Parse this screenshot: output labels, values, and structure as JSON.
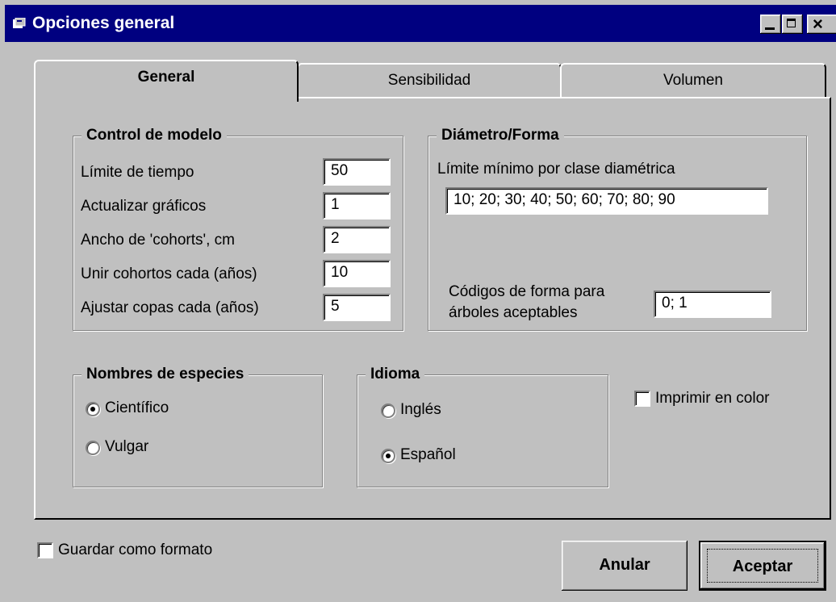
{
  "window": {
    "title": "Opciones general"
  },
  "tabs": [
    "General",
    "Sensibilidad",
    "Volumen"
  ],
  "control_modelo": {
    "legend": "Control de modelo",
    "rows": [
      {
        "label": "Límite de tiempo",
        "value": "50"
      },
      {
        "label": "Actualizar gráficos",
        "value": "1"
      },
      {
        "label": "Ancho de 'cohorts', cm",
        "value": "2"
      },
      {
        "label": "Unir cohortos cada (años)",
        "value": "10"
      },
      {
        "label": "Ajustar copas cada (años)",
        "value": "5"
      }
    ]
  },
  "diametro_forma": {
    "legend": "Diámetro/Forma",
    "limite_label": "Límite mínimo por clase diamétrica",
    "limite_value": "10; 20; 30; 40; 50; 60; 70; 80; 90",
    "codigos_label_1": "Códigos de forma para",
    "codigos_label_2": "árboles aceptables",
    "codigos_value": "0; 1"
  },
  "nombres_especies": {
    "legend": "Nombres de especies",
    "options": [
      "Científico",
      "Vulgar"
    ],
    "selected": "Científico"
  },
  "idioma": {
    "legend": "Idioma",
    "options": [
      "Inglés",
      "Español"
    ],
    "selected": "Español"
  },
  "imprimir_color": {
    "label": "Imprimir en color",
    "checked": false
  },
  "guardar_formato": {
    "label": "Guardar como formato",
    "checked": false
  },
  "buttons": {
    "cancel": "Anular",
    "ok": "Aceptar"
  }
}
